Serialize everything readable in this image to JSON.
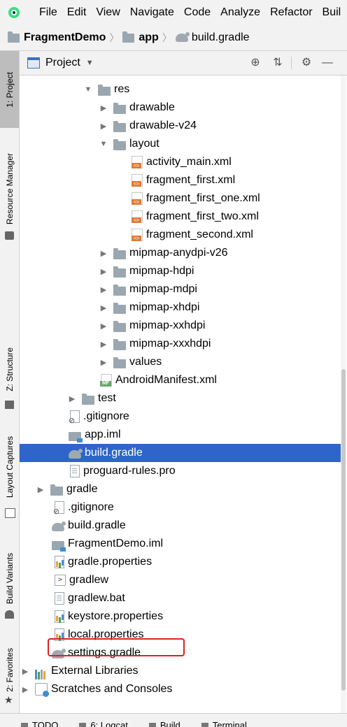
{
  "menubar": {
    "items": [
      "File",
      "Edit",
      "View",
      "Navigate",
      "Code",
      "Analyze",
      "Refactor",
      "Buil"
    ]
  },
  "breadcrumb": {
    "items": [
      "FragmentDemo",
      "app",
      "build.gradle"
    ]
  },
  "left_strip": {
    "tabs": [
      "1: Project",
      "Resource Manager",
      "Z: Structure",
      "Layout Captures",
      "Build Variants",
      "2: Favorites"
    ]
  },
  "panel": {
    "title": "Project"
  },
  "tree": [
    {
      "label": "res"
    },
    {
      "label": "drawable"
    },
    {
      "label": "drawable-v24"
    },
    {
      "label": "layout"
    },
    {
      "label": "activity_main.xml"
    },
    {
      "label": "fragment_first.xml"
    },
    {
      "label": "fragment_first_one.xml"
    },
    {
      "label": "fragment_first_two.xml"
    },
    {
      "label": "fragment_second.xml"
    },
    {
      "label": "mipmap-anydpi-v26"
    },
    {
      "label": "mipmap-hdpi"
    },
    {
      "label": "mipmap-mdpi"
    },
    {
      "label": "mipmap-xhdpi"
    },
    {
      "label": "mipmap-xxhdpi"
    },
    {
      "label": "mipmap-xxxhdpi"
    },
    {
      "label": "values"
    },
    {
      "label": "AndroidManifest.xml"
    },
    {
      "label": "test"
    },
    {
      "label": ".gitignore"
    },
    {
      "label": "app.iml"
    },
    {
      "label": "build.gradle"
    },
    {
      "label": "proguard-rules.pro"
    },
    {
      "label": "gradle"
    },
    {
      "label": ".gitignore"
    },
    {
      "label": "build.gradle"
    },
    {
      "label": "FragmentDemo.iml"
    },
    {
      "label": "gradle.properties"
    },
    {
      "label": "gradlew"
    },
    {
      "label": "gradlew.bat"
    },
    {
      "label": "keystore.properties"
    },
    {
      "label": "local.properties"
    },
    {
      "label": "settings.gradle"
    },
    {
      "label": "External Libraries"
    },
    {
      "label": "Scratches and Consoles"
    }
  ],
  "bottom_tabs": [
    "TODO",
    "6: Logcat",
    "Build",
    "Terminal"
  ],
  "colors": {
    "selection": "#2f65ca",
    "highlight_box": "#e02020"
  }
}
